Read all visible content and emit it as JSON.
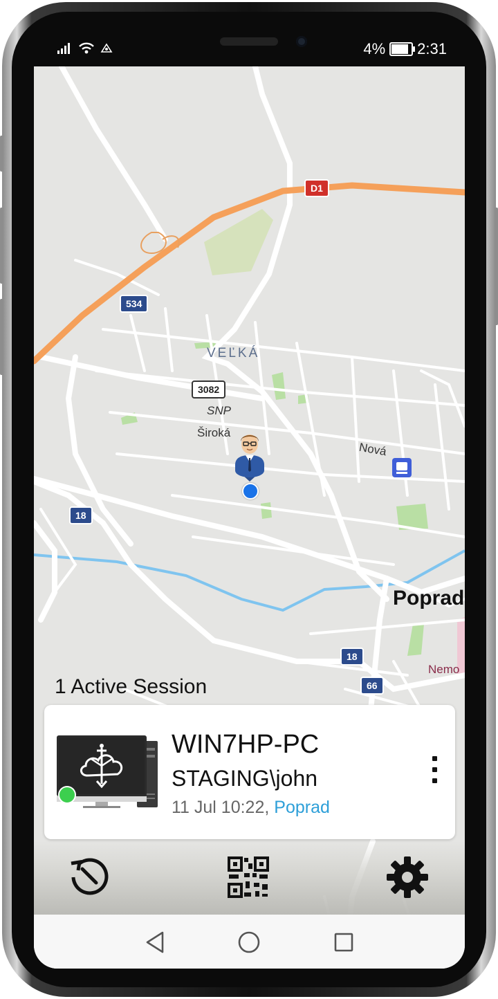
{
  "status_bar": {
    "battery_text": "4%",
    "battery_level": 0.04,
    "time": "2:31"
  },
  "map": {
    "district_label": "VEĽKÁ",
    "city_label": "Poprad",
    "poi_label": "Nemo",
    "street_labels": {
      "snp": "SNP",
      "siroka": "Široká",
      "nova": "Nová"
    },
    "road_shields": {
      "d1": "D1",
      "r534": "534",
      "r3082": "3082",
      "r18_west": "18",
      "r18_east": "18",
      "r66": "66"
    }
  },
  "sessions": {
    "count_label": "1 Active Session",
    "items": [
      {
        "host": "WIN7HP-PC",
        "user": "STAGING\\john",
        "datetime": "11 Jul 10:22",
        "separator": ", ",
        "location": "Poprad",
        "status": "online"
      }
    ]
  },
  "toolbar": {
    "history_icon": "history-icon",
    "qr_icon": "qr-code-icon",
    "settings_icon": "gear-icon"
  },
  "android_nav": {
    "back": "back-icon",
    "home": "home-icon",
    "recents": "recents-icon"
  },
  "colors": {
    "online": "#3ccf4e",
    "location_link": "#2d9fd8",
    "map_background": "#e5e5e3",
    "highway": "#f5a05a"
  }
}
